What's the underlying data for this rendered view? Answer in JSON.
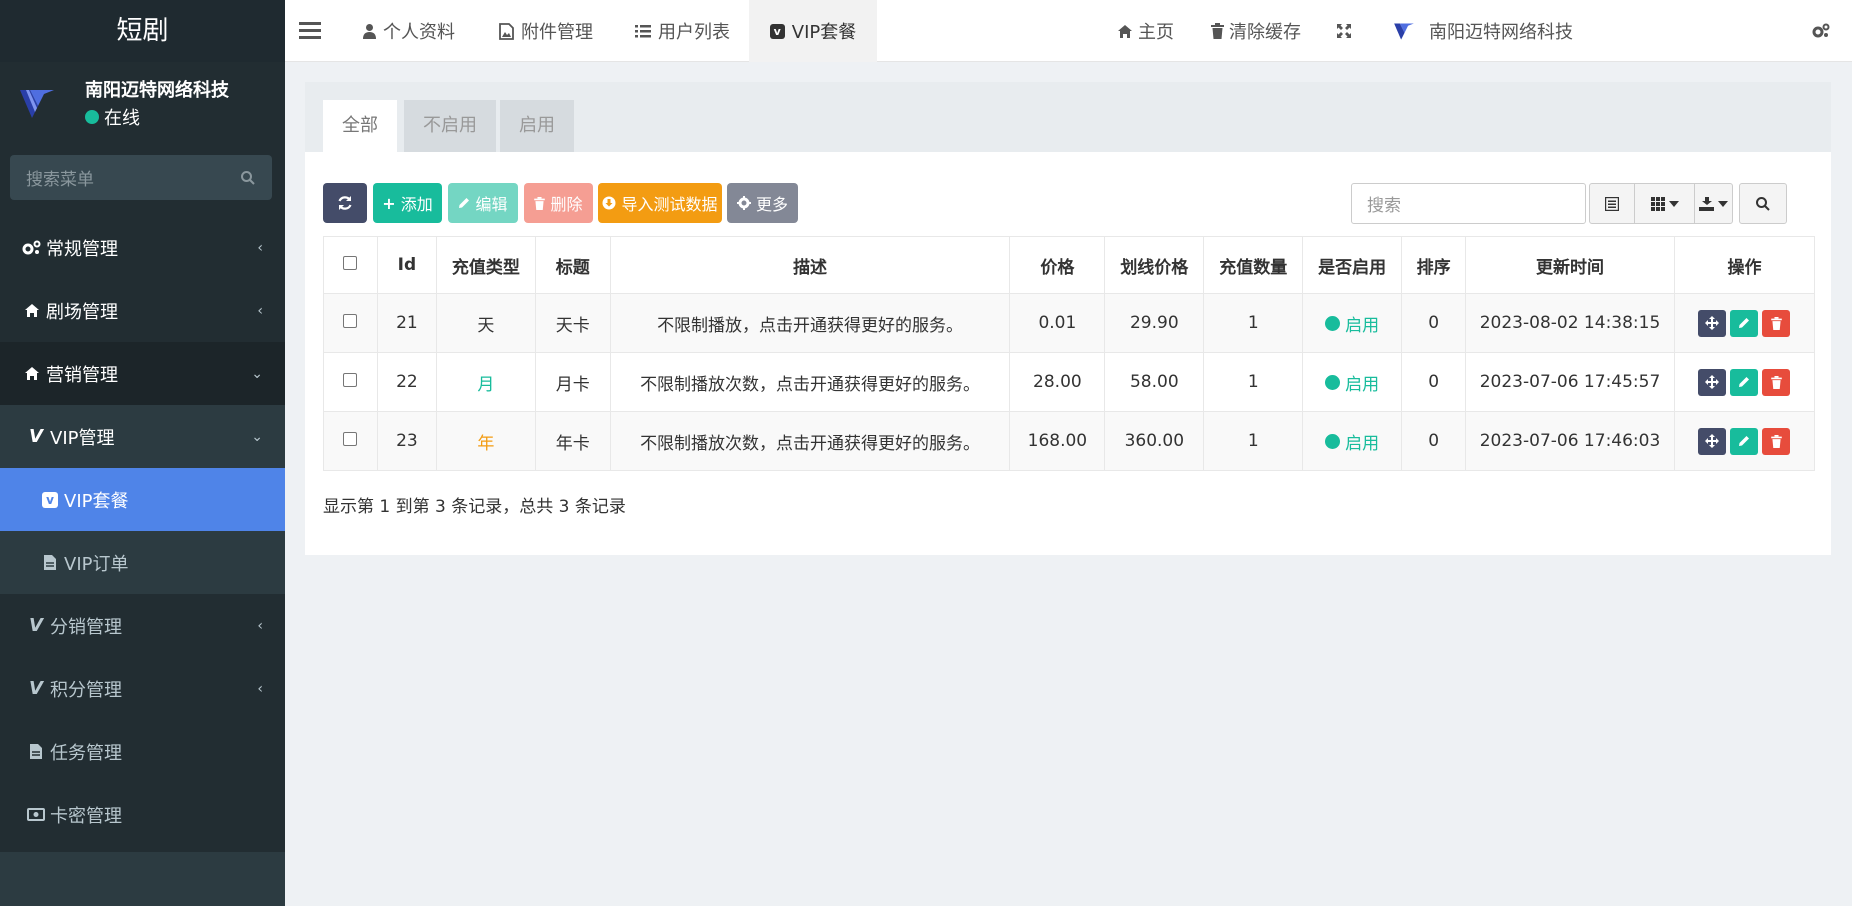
{
  "sidebar": {
    "brand": "短剧",
    "user_name": "南阳迈特网络科技",
    "user_status": "在线",
    "search_placeholder": "搜索菜单",
    "items": [
      {
        "label": "常规管理"
      },
      {
        "label": "剧场管理"
      },
      {
        "label": "营销管理"
      },
      {
        "label": "VIP管理"
      },
      {
        "label": "VIP套餐"
      },
      {
        "label": "VIP订单"
      },
      {
        "label": "分销管理"
      },
      {
        "label": "积分管理"
      },
      {
        "label": "任务管理"
      },
      {
        "label": "卡密管理"
      }
    ]
  },
  "topnav": {
    "tabs": [
      {
        "label": "个人资料"
      },
      {
        "label": "附件管理"
      },
      {
        "label": "用户列表"
      },
      {
        "label": "VIP套餐"
      }
    ],
    "home": "主页",
    "clear_cache": "清除缓存",
    "company": "南阳迈特网络科技"
  },
  "panel": {
    "tabs": [
      "全部",
      "不启用",
      "启用"
    ],
    "buttons": {
      "add": "添加",
      "edit": "编辑",
      "delete": "删除",
      "import": "导入测试数据",
      "more": "更多"
    },
    "search_placeholder": "搜索",
    "columns": [
      "Id",
      "充值类型",
      "标题",
      "描述",
      "价格",
      "划线价格",
      "充值数量",
      "是否启用",
      "排序",
      "更新时间",
      "操作"
    ],
    "rows": [
      {
        "id": "21",
        "type": "天",
        "title": "天卡",
        "desc": "不限制播放，点击开通获得更好的服务。",
        "price": "0.01",
        "strike": "29.90",
        "qty": "1",
        "status": "启用",
        "sort": "0",
        "updated": "2023-08-02 14:38:15"
      },
      {
        "id": "22",
        "type": "月",
        "title": "月卡",
        "desc": "不限制播放次数，点击开通获得更好的服务。",
        "price": "28.00",
        "strike": "58.00",
        "qty": "1",
        "status": "启用",
        "sort": "0",
        "updated": "2023-07-06 17:45:57"
      },
      {
        "id": "23",
        "type": "年",
        "title": "年卡",
        "desc": "不限制播放次数，点击开通获得更好的服务。",
        "price": "168.00",
        "strike": "360.00",
        "qty": "1",
        "status": "启用",
        "sort": "0",
        "updated": "2023-07-06 17:46:03"
      }
    ],
    "footer": "显示第 1 到第 3 条记录，总共 3 条记录"
  },
  "colors": {
    "sidebar_bg": "#222d32",
    "active_menu": "#4f84e8",
    "success": "#18bc9c",
    "type_day": "#333333",
    "type_month": "#18bc9c",
    "type_year": "#f39c12"
  }
}
